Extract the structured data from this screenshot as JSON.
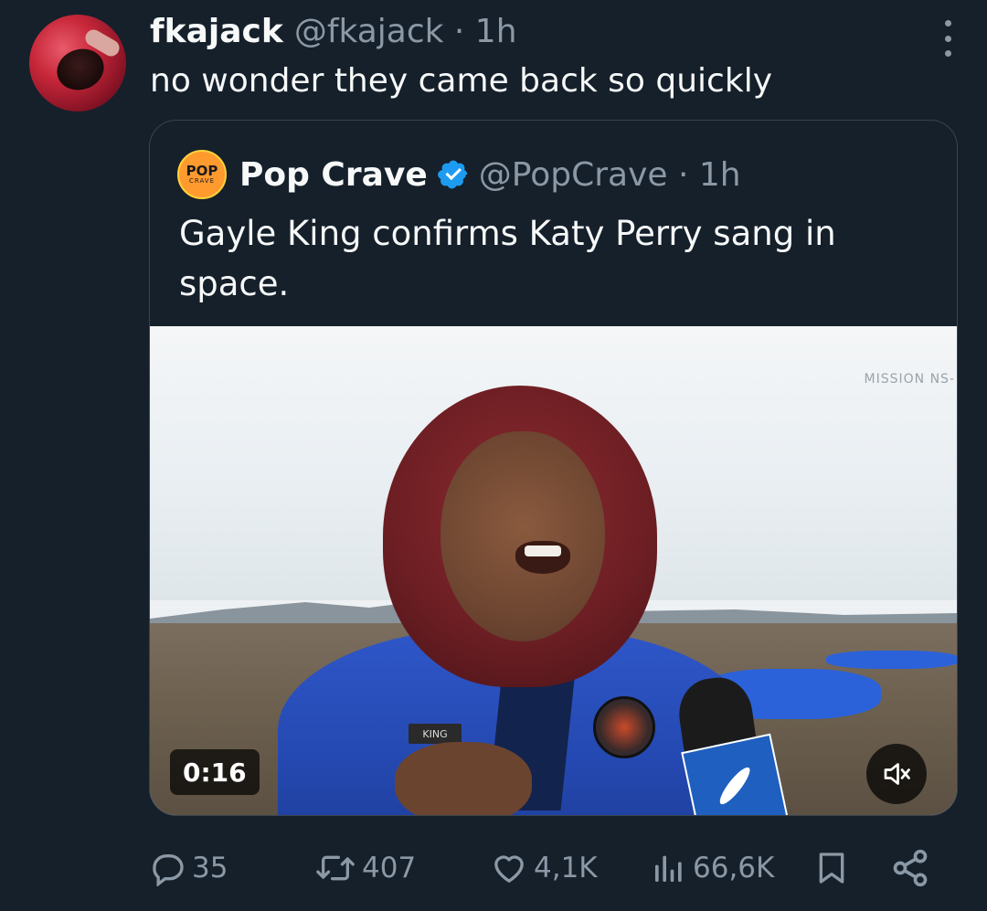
{
  "tweet": {
    "author_name": "fkajack",
    "author_handle": "@fkajack",
    "time": "· 1h",
    "text": "no wonder they came back so quickly"
  },
  "quoted": {
    "logo_line1": "POP",
    "logo_line2": "CRAVE",
    "author_name": "Pop Crave",
    "author_handle": "@PopCrave",
    "time": "· 1h",
    "text": "Gayle King confirms Katy Perry sang in space.",
    "media": {
      "watermark": "MISSION NS-",
      "name_tag": "KING",
      "duration": "0:16",
      "muted": true
    }
  },
  "actions": {
    "replies": "35",
    "retweets": "407",
    "likes": "4,1K",
    "views": "66,6K"
  },
  "colors": {
    "background": "#15202b",
    "text_primary": "#f7f9f9",
    "text_secondary": "#8b98a5",
    "border": "#38444d",
    "verified": "#1d9bf0"
  },
  "icons": [
    "more-icon",
    "verified-icon",
    "mute-icon",
    "reply-icon",
    "retweet-icon",
    "like-icon",
    "views-icon",
    "bookmark-icon",
    "share-icon"
  ]
}
